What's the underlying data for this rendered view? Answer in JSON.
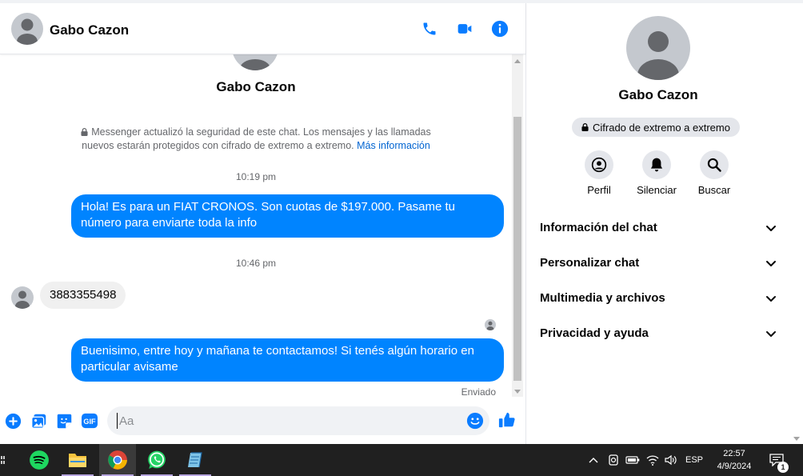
{
  "header": {
    "contact_name": "Gabo Cazon",
    "icons": [
      "phone-icon",
      "video-camera-icon",
      "info-icon"
    ]
  },
  "conversation": {
    "intro_name": "Gabo Cazon",
    "e2e_notice": "Messenger actualizó la seguridad de este chat. Los mensajes y las llamadas nuevos estarán protegidos con cifrado de extremo a extremo.",
    "e2e_link": "Más información",
    "messages": [
      {
        "type": "timestamp",
        "text": "10:19 pm"
      },
      {
        "type": "outgoing",
        "text": "Hola! Es para un FIAT CRONOS. Son cuotas de $197.000. Pasame tu número para enviarte toda la info"
      },
      {
        "type": "timestamp",
        "text": "10:46 pm"
      },
      {
        "type": "incoming",
        "text": "3883355498"
      },
      {
        "type": "outgoing",
        "text": "Buenisimo, entre hoy y mañana te contactamos! Si tenés algún horario en particular avisame"
      }
    ],
    "sent_status": "Enviado"
  },
  "composer": {
    "placeholder": "Aa",
    "value": "",
    "icons": [
      "plus-circle-icon",
      "photo-icon",
      "sticker-icon",
      "gif-icon",
      "emoji-icon",
      "thumbs-up-icon"
    ],
    "gif_label": "GIF"
  },
  "info_panel": {
    "name": "Gabo Cazon",
    "e2e_badge": "Cifrado de extremo a extremo",
    "actions": [
      {
        "label": "Perfil",
        "icon": "profile-icon"
      },
      {
        "label": "Silenciar",
        "icon": "bell-icon"
      },
      {
        "label": "Buscar",
        "icon": "search-icon"
      }
    ],
    "sections": [
      {
        "title": "Información del chat"
      },
      {
        "title": "Personalizar chat"
      },
      {
        "title": "Multimedia y archivos"
      },
      {
        "title": "Privacidad y ayuda"
      }
    ]
  },
  "taskbar": {
    "apps": [
      "spotify-icon",
      "file-explorer-icon",
      "chrome-icon",
      "whatsapp-icon",
      "notepad-icon"
    ],
    "language": "ESP",
    "time": "22:57",
    "date": "4/9/2024",
    "notification_count": "1"
  },
  "colors": {
    "messenger_blue": "#0084ff",
    "icon_blue": "#0a7cff",
    "taskbar": "#202020"
  }
}
